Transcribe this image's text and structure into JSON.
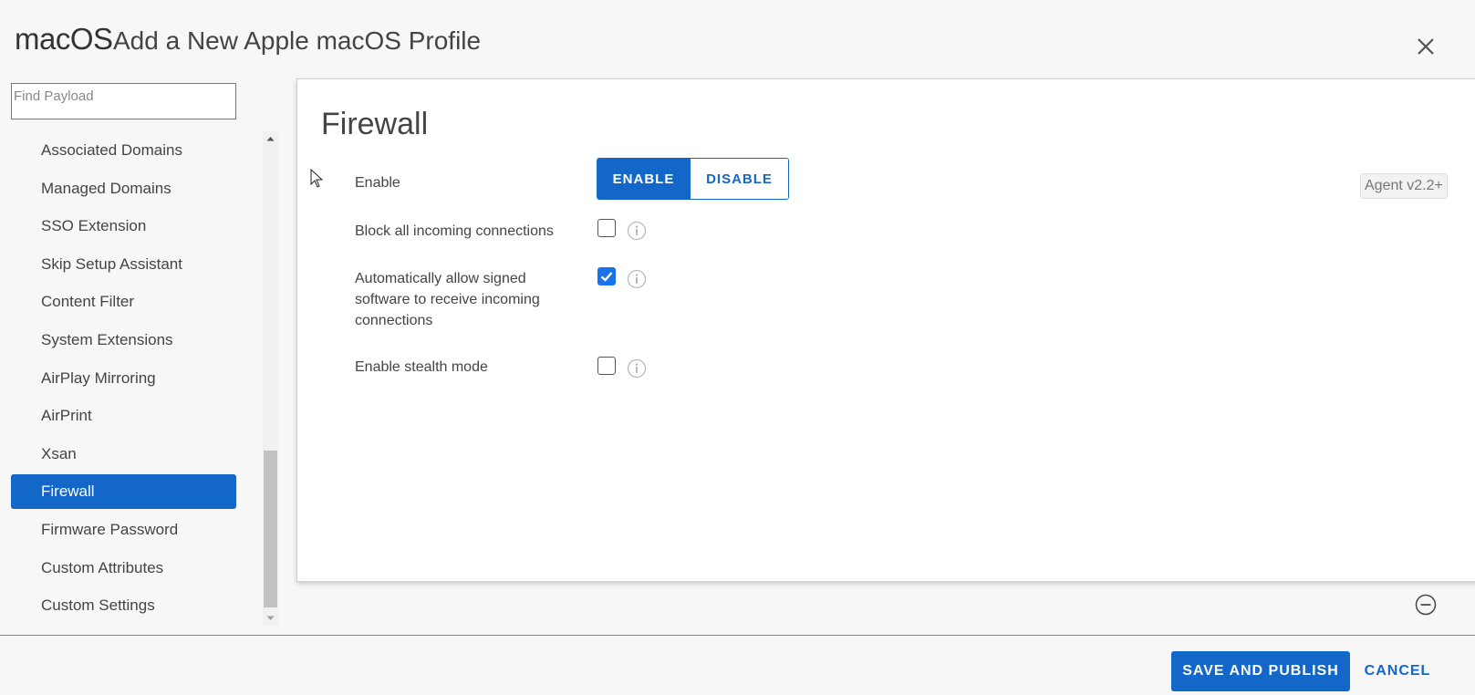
{
  "header": {
    "os_name": "macOS",
    "title": "Add a New Apple macOS Profile"
  },
  "sidebar": {
    "search_placeholder": "Find Payload",
    "items": [
      {
        "label": "Associated Domains",
        "active": false
      },
      {
        "label": "Managed Domains",
        "active": false
      },
      {
        "label": "SSO Extension",
        "active": false
      },
      {
        "label": "Skip Setup Assistant",
        "active": false
      },
      {
        "label": "Content Filter",
        "active": false
      },
      {
        "label": "System Extensions",
        "active": false
      },
      {
        "label": "AirPlay Mirroring",
        "active": false
      },
      {
        "label": "AirPrint",
        "active": false
      },
      {
        "label": "Xsan",
        "active": false
      },
      {
        "label": "Firewall",
        "active": true
      },
      {
        "label": "Firmware Password",
        "active": false
      },
      {
        "label": "Custom Attributes",
        "active": false
      },
      {
        "label": "Custom Settings",
        "active": false
      }
    ]
  },
  "panel": {
    "title": "Firewall",
    "enable": {
      "label": "Enable",
      "on_label": "ENABLE",
      "off_label": "DISABLE",
      "selected": "ENABLE"
    },
    "agent_badge": "Agent v2.2+",
    "options": [
      {
        "label": "Block all incoming connections",
        "checked": false
      },
      {
        "label": "Automatically allow signed software to receive incoming connections",
        "checked": true
      },
      {
        "label": "Enable stealth mode",
        "checked": false
      }
    ]
  },
  "footer": {
    "save_label": "SAVE AND PUBLISH",
    "cancel_label": "CANCEL"
  },
  "colors": {
    "accent": "#1367c9",
    "checkbox_checked": "#1a73e8"
  }
}
